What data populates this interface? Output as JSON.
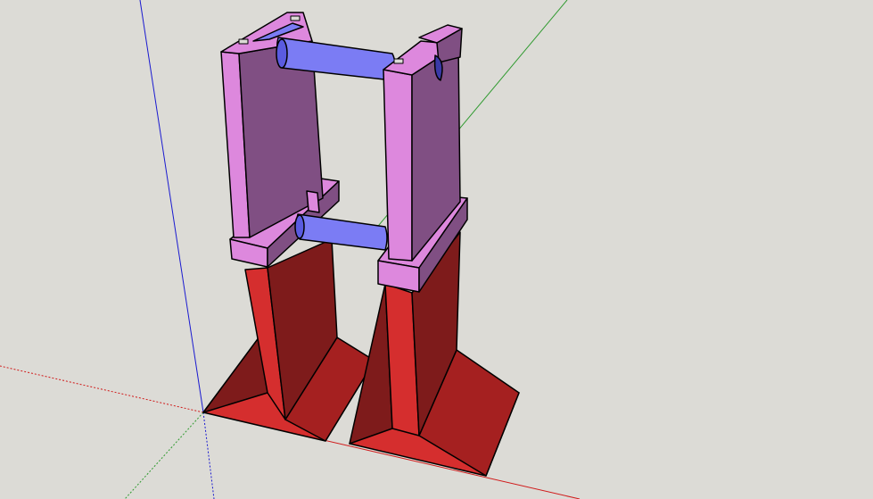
{
  "app": {
    "viewport": {
      "background": "#dcdbd6",
      "mode": "3d-model-view"
    },
    "model": {
      "name": "",
      "parts": [
        {
          "name": "left-base",
          "color_face": "#d52e2e",
          "color_side": "#7e1b1b"
        },
        {
          "name": "right-base",
          "color_face": "#d52e2e",
          "color_side": "#7e1b1b"
        },
        {
          "name": "left-post",
          "color_face": "#dd88dd",
          "color_side": "#804f83"
        },
        {
          "name": "right-post",
          "color_face": "#dd88dd",
          "color_side": "#804f83"
        },
        {
          "name": "upper-rod",
          "color": "#7b7cf4"
        },
        {
          "name": "lower-rod",
          "color": "#7b7cf4"
        }
      ]
    },
    "axes": {
      "red": "#d01a1a",
      "green": "#2f9a2f",
      "blue": "#1a1ad0"
    }
  }
}
